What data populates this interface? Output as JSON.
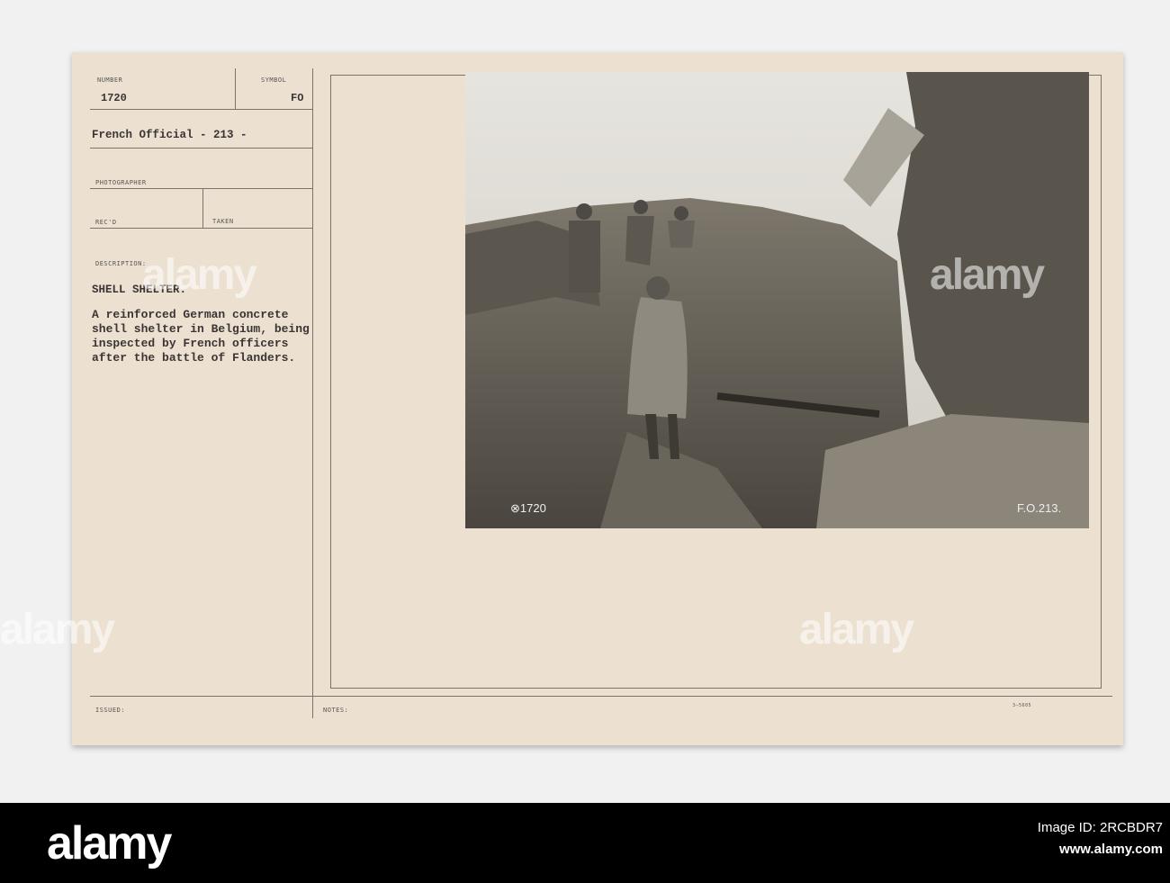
{
  "card": {
    "number_label": "NUMBER",
    "number_value": "1720",
    "symbol_label": "SYMBOL",
    "symbol_value": "FO",
    "series": "French Official - 213 -",
    "photographer_label": "PHOTOGRAPHER",
    "recd_label": "REC'D",
    "taken_label": "TAKEN",
    "description_label": "DESCRIPTION:",
    "title": "SHELL SHELTER.",
    "description_lines": [
      "A reinforced German concrete",
      "shell shelter in Belgium, being",
      "inspected by French officers",
      "after the battle of Flanders."
    ],
    "issued_label": "ISSUED:",
    "notes_label": "NOTES:",
    "form_number": "3—5605"
  },
  "photo": {
    "caption_left": "⊗1720",
    "caption_right": "F.O.213."
  },
  "watermark": {
    "text": "alamy",
    "image_id": "Image ID: 2RCBDR7",
    "url": "www.alamy.com"
  }
}
